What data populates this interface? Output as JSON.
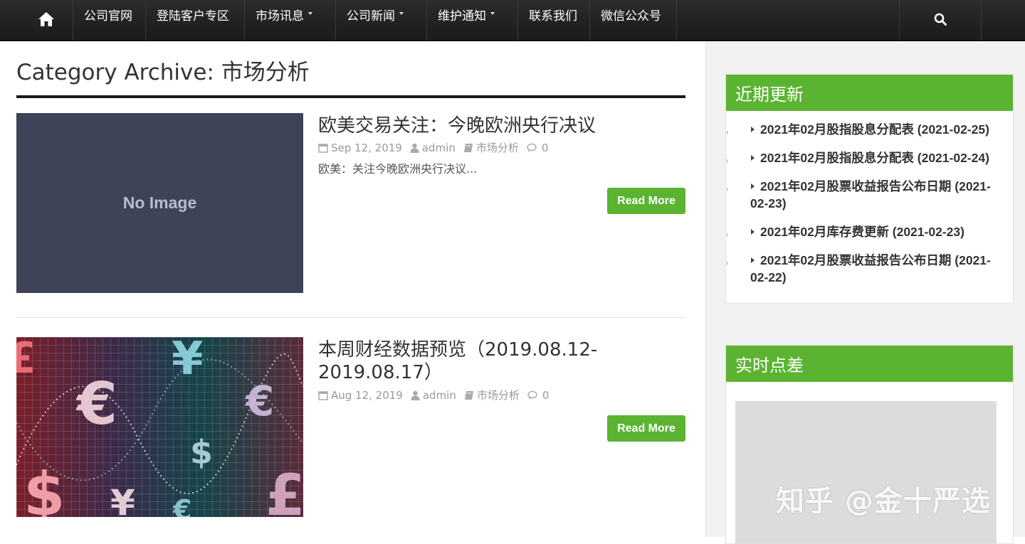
{
  "nav": {
    "items": [
      {
        "label": "公司官网",
        "dropdown": false
      },
      {
        "label": "登陆客户专区",
        "dropdown": false
      },
      {
        "label": "市场讯息",
        "dropdown": true
      },
      {
        "label": "公司新闻",
        "dropdown": true
      },
      {
        "label": "维护通知",
        "dropdown": true
      },
      {
        "label": "联系我们",
        "dropdown": false
      },
      {
        "label": "微信公众号",
        "dropdown": false
      }
    ]
  },
  "page": {
    "title": "Category Archive: 市场分析"
  },
  "posts": [
    {
      "title": "欧美交易关注：今晚欧洲央行决议",
      "date": "Sep 12, 2019",
      "author": "admin",
      "category": "市场分析",
      "comments": "0",
      "excerpt": "欧美：关注今晚欧洲央行决议...",
      "thumb_text": "No Image",
      "read_more": "Read More"
    },
    {
      "title": "本周财经数据预览（2019.08.12-2019.08.17）",
      "date": "Aug 12, 2019",
      "author": "admin",
      "category": "市场分析",
      "comments": "0",
      "read_more": "Read More"
    }
  ],
  "sidebar": {
    "recent": {
      "heading": "近期更新",
      "items": [
        "2021年02月股指股息分配表 (2021-02-25)",
        "2021年02月股指股息分配表 (2021-02-24)",
        "2021年02月股票收益报告公布日期 (2021-02-23)",
        "2021年02月库存费更新 (2021-02-23)",
        "2021年02月股票收益报告公布日期 (2021-02-22)"
      ]
    },
    "spread": {
      "heading": "实时点差"
    }
  },
  "watermark": "知乎 @金十严选",
  "colors": {
    "accent": "#5bb431",
    "nav_bg": "#1f1f1f",
    "placeholder": "#3f4357"
  }
}
